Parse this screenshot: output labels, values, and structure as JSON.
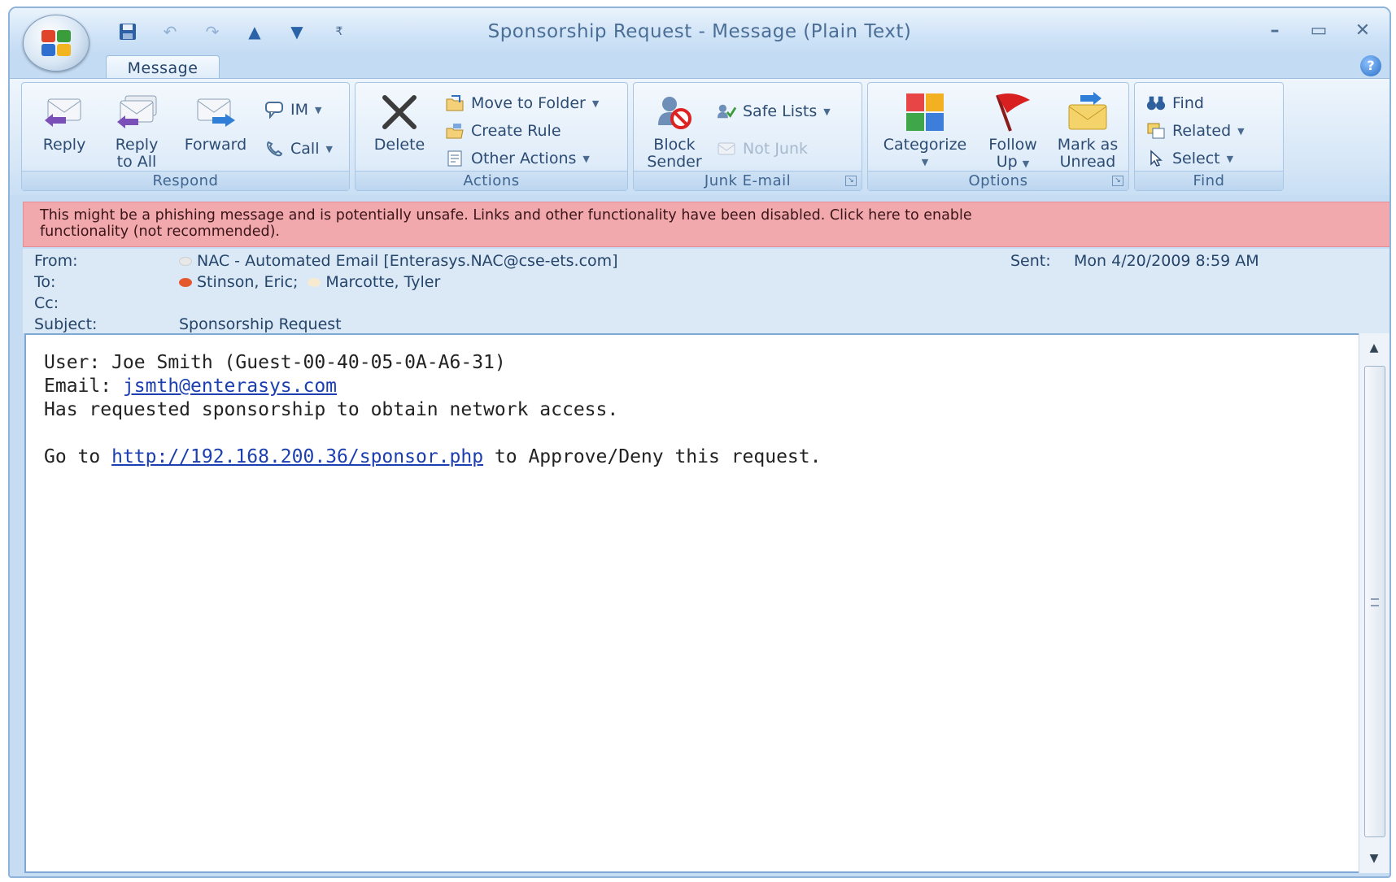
{
  "window": {
    "title": "Sponsorship Request - Message (Plain Text)"
  },
  "ribbon": {
    "tab": "Message",
    "respond": {
      "label": "Respond",
      "reply": "Reply",
      "reply_all_1": "Reply",
      "reply_all_2": "to All",
      "forward": "Forward",
      "im": "IM",
      "call": "Call"
    },
    "actions": {
      "label": "Actions",
      "delete": "Delete",
      "move": "Move to Folder",
      "create_rule": "Create Rule",
      "other": "Other Actions"
    },
    "junk": {
      "label": "Junk E-mail",
      "block_1": "Block",
      "block_2": "Sender",
      "safe_lists": "Safe Lists",
      "not_junk": "Not Junk"
    },
    "options": {
      "label": "Options",
      "categorize": "Categorize",
      "follow_1": "Follow",
      "follow_2": "Up",
      "mark_1": "Mark as",
      "mark_2": "Unread"
    },
    "find": {
      "label": "Find",
      "find": "Find",
      "related": "Related",
      "select": "Select"
    }
  },
  "infobar": {
    "line1": "This might be a phishing message and is potentially unsafe. Links and other functionality have been disabled. Click here to enable",
    "line2": "functionality (not recommended)."
  },
  "headers": {
    "from_label": "From:",
    "from_value": "NAC - Automated Email [Enterasys.NAC@cse-ets.com]",
    "to_label": "To:",
    "to_1": "Stinson, Eric;",
    "to_2": "Marcotte, Tyler",
    "cc_label": "Cc:",
    "subject_label": "Subject:",
    "subject_value": "Sponsorship Request",
    "sent_label": "Sent:",
    "sent_value": "Mon 4/20/2009 8:59 AM"
  },
  "body": {
    "line1": "User: Joe Smith (Guest-00-40-05-0A-A6-31)",
    "email_prefix": "Email: ",
    "email_link": "jsmth@enterasys.com",
    "line3": "Has requested sponsorship to obtain network access.",
    "go_prefix": "Go to ",
    "url": "http://192.168.200.36/sponsor.php",
    "go_suffix": " to Approve/Deny this request."
  },
  "colors": {
    "infobar": "#f2a9ad",
    "link": "#1b3fb0",
    "ribbon": "#dcebf9"
  },
  "icons": [
    "office-button-icon",
    "save-icon",
    "undo-icon",
    "redo-icon",
    "up-arrow-icon",
    "down-arrow-icon",
    "customize-icon",
    "minimize-icon",
    "maximize-icon",
    "close-icon",
    "help-icon"
  ]
}
